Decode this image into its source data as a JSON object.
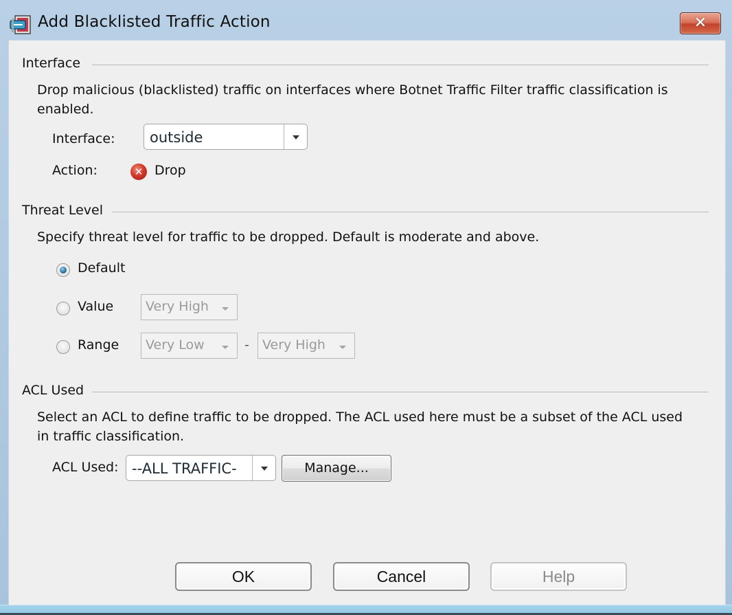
{
  "window": {
    "title": "Add Blacklisted Traffic Action",
    "close_label": "✕"
  },
  "interface_group": {
    "title": "Interface",
    "description_line1": "Drop malicious (blacklisted) traffic on interfaces where Botnet Traffic Filter traffic classification is",
    "description_line2": "enabled.",
    "interface_label": "Interface:",
    "interface_value": "outside",
    "action_label": "Action:",
    "action_value": "Drop"
  },
  "threat_group": {
    "title": "Threat Level",
    "description": "Specify threat level for traffic to be dropped. Default is moderate and above.",
    "options": [
      {
        "label": "Default",
        "checked": true
      },
      {
        "label": "Value",
        "checked": false
      },
      {
        "label": "Range",
        "checked": false
      }
    ],
    "value_select": "Very High",
    "range_from": "Very Low",
    "range_sep": "-",
    "range_to": "Very High"
  },
  "acl_group": {
    "title": "ACL Used",
    "description_line1": "Select an ACL to define traffic to be dropped. The ACL used here must be a subset of the ACL used",
    "description_line2": "in traffic classification.",
    "acl_label": "ACL Used:",
    "acl_value": "--ALL TRAFFIC-",
    "manage_label": "Manage..."
  },
  "footer": {
    "ok_label": "OK",
    "cancel_label": "Cancel",
    "help_label": "Help"
  }
}
